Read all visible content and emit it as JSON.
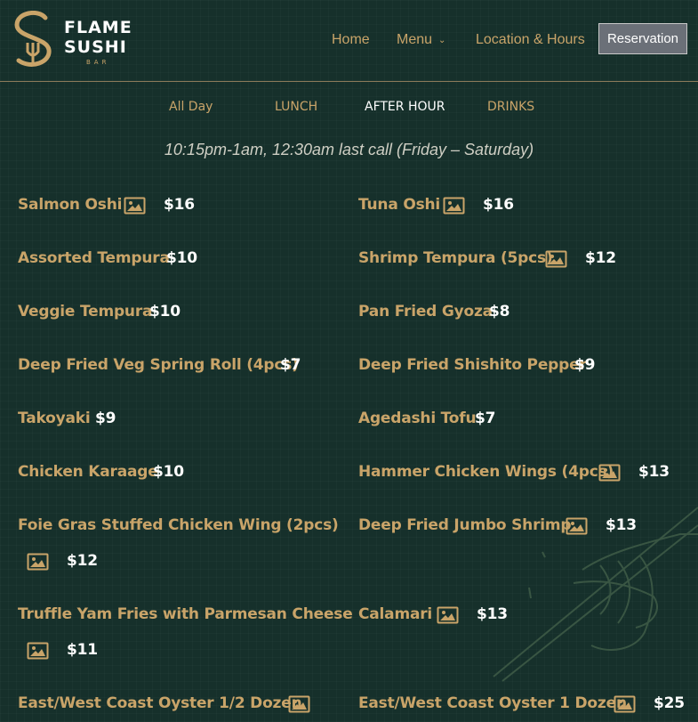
{
  "logo": {
    "line1": "FLAME",
    "line2": "SUSHI",
    "line3": "BAR"
  },
  "nav": {
    "home": "Home",
    "menu": "Menu",
    "location": "Location & Hours",
    "reservation": "Reservation"
  },
  "tabs": [
    "All Day",
    "LUNCH",
    "AFTER HOUR",
    "DRINKS"
  ],
  "active_tab": "AFTER HOUR",
  "hours_note": "10:15pm-1am, 12:30am last call (Friday – Saturday)",
  "left_items": [
    {
      "name": "Salmon Oshi",
      "price": "$16",
      "has_image": true
    },
    {
      "name": "Assorted Tempura",
      "price": "$10",
      "has_image": false
    },
    {
      "name": "Veggie Tempura",
      "price": "$10",
      "has_image": false
    },
    {
      "name": "Deep Fried Veg Spring Roll (4pcs)",
      "price": "$7",
      "has_image": false
    },
    {
      "name": "Takoyaki",
      "price": "$9",
      "has_image": false
    },
    {
      "name": "Chicken Karaage",
      "price": "$10",
      "has_image": false
    },
    {
      "name": "Foie Gras Stuffed Chicken Wing (2pcs)",
      "price": "$12",
      "has_image": true
    },
    {
      "name": "Truffle Yam Fries with Parmesan Cheese",
      "price": "$11",
      "has_image": true
    },
    {
      "name": "East/West Coast Oyster 1/2 Dozen",
      "price": "",
      "has_image": true
    }
  ],
  "right_items": [
    {
      "name": "Tuna Oshi",
      "price": "$16",
      "has_image": true
    },
    {
      "name": "Shrimp Tempura (5pcs)",
      "price": "$12",
      "has_image": true
    },
    {
      "name": "Pan Fried Gyoza",
      "price": "$8",
      "has_image": false
    },
    {
      "name": "Deep Fried Shishito Pepper",
      "price": "$9",
      "has_image": false
    },
    {
      "name": "Agedashi Tofu",
      "price": "$7",
      "has_image": false
    },
    {
      "name": "Hammer Chicken Wings (4pcs)",
      "price": "$13",
      "has_image": true
    },
    {
      "name": "Deep Fried Jumbo Shrimp",
      "price": "$13",
      "has_image": true
    },
    {
      "name": "Calamari",
      "price": "$13",
      "has_image": true
    },
    {
      "name": "East/West Coast Oyster 1 Dozen",
      "price": "$25",
      "has_image": true
    }
  ],
  "colors": {
    "background": "#16302b",
    "gold": "#c9a469",
    "price": "#ffffff"
  }
}
